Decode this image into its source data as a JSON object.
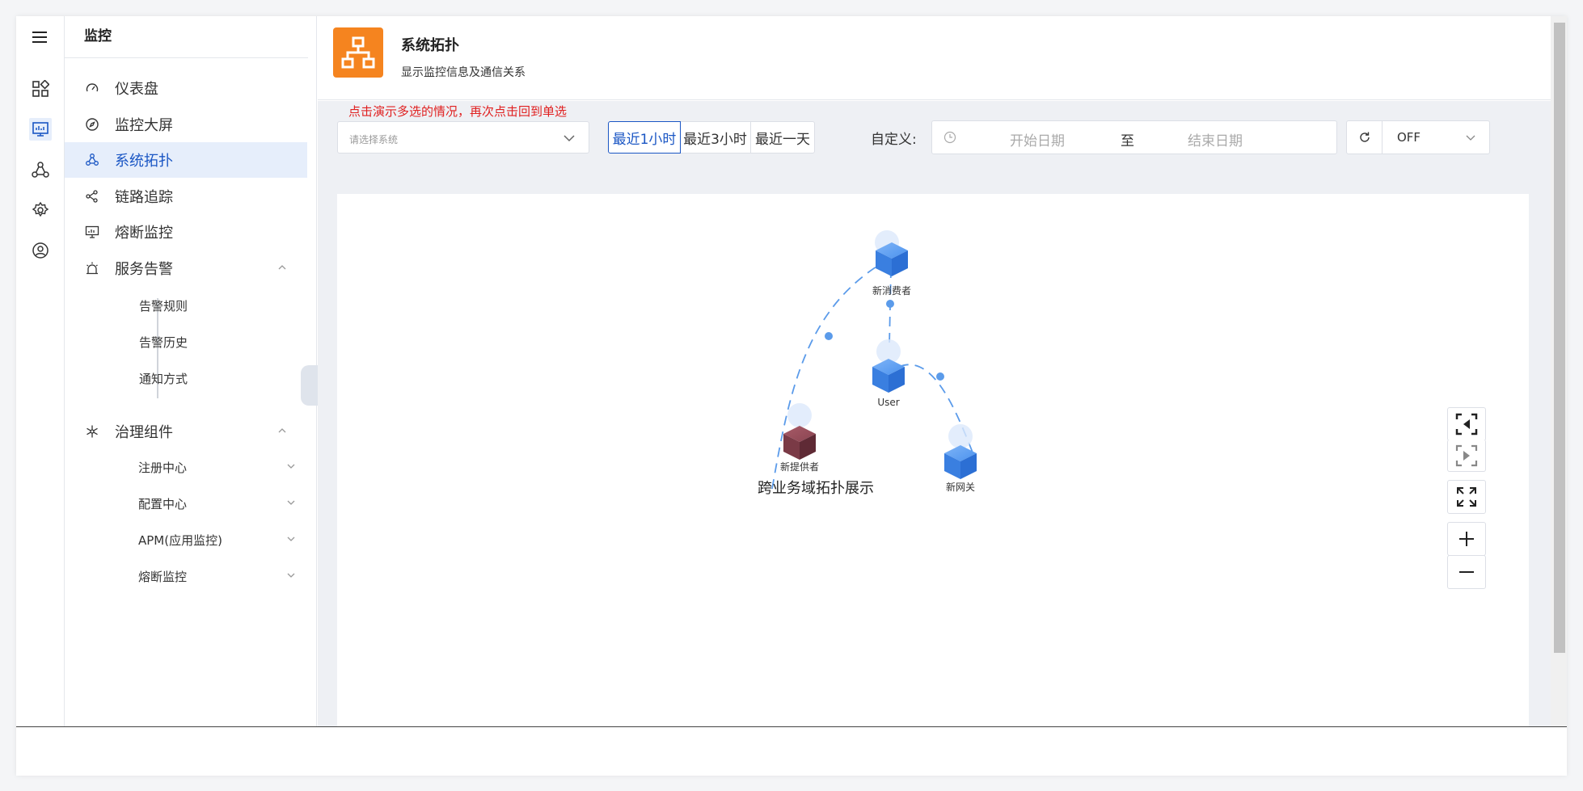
{
  "menu": {
    "title": "监控",
    "items": [
      {
        "label": "仪表盘"
      },
      {
        "label": "监控大屏"
      },
      {
        "label": "系统拓扑"
      },
      {
        "label": "链路追踪"
      },
      {
        "label": "熔断监控"
      },
      {
        "label": "服务告警"
      },
      {
        "label": "治理组件"
      }
    ],
    "alert_sub": [
      {
        "label": "告警规则"
      },
      {
        "label": "告警历史"
      },
      {
        "label": "通知方式"
      }
    ],
    "governance_sub": [
      {
        "label": "注册中心"
      },
      {
        "label": "配置中心"
      },
      {
        "label": "APM(应用监控)"
      },
      {
        "label": "熔断监控"
      }
    ]
  },
  "header": {
    "title": "系统拓扑",
    "subtitle": "显示监控信息及通信关系"
  },
  "toolbar": {
    "hint": "点击演示多选的情况，再次点击回到单选",
    "system_select_placeholder": "请选择系统",
    "ranges": [
      {
        "label": "最近1小时"
      },
      {
        "label": "最近3小时"
      },
      {
        "label": "最近一天"
      }
    ],
    "active_range": "最近1小时",
    "custom_label": "自定义:",
    "start_placeholder": "开始日期",
    "to_label": "至",
    "end_placeholder": "结束日期",
    "refresh_value": "OFF"
  },
  "topology": {
    "group_label": "跨业务域拓扑展示",
    "nodes": [
      {
        "id": "consumer",
        "label": "新消费者",
        "color": "#3d86e8"
      },
      {
        "id": "user",
        "label": "User",
        "color": "#3d86e8"
      },
      {
        "id": "provider",
        "label": "新提供者",
        "color": "#7d3b48"
      },
      {
        "id": "gateway",
        "label": "新网关",
        "color": "#3d86e8"
      }
    ],
    "edges": [
      {
        "from": "provider",
        "to": "consumer"
      },
      {
        "from": "consumer",
        "to": "user"
      },
      {
        "from": "user",
        "to": "gateway"
      }
    ]
  },
  "colors": {
    "accent": "#1a56c4",
    "header_logo": "#f5841f",
    "hint": "#e02020",
    "edge": "#5b9bea"
  }
}
